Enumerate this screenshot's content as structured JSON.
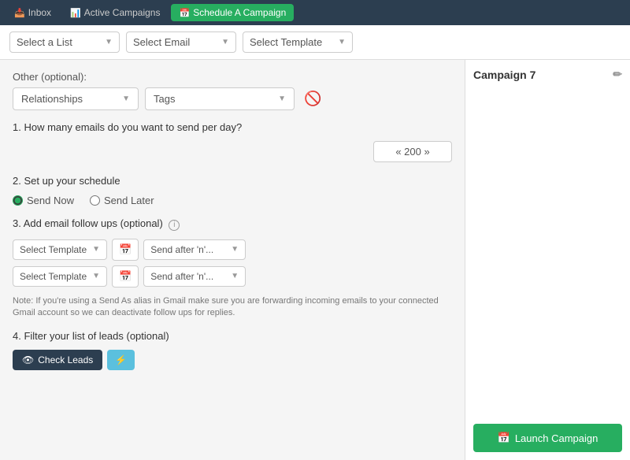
{
  "topnav": {
    "inbox_label": "Inbox",
    "active_campaigns_label": "Active Campaigns",
    "schedule_campaign_label": "Schedule A Campaign",
    "inbox_icon": "📥",
    "active_icon": "📊",
    "schedule_icon": "📅"
  },
  "subheader": {
    "list_placeholder": "Select a List",
    "email_placeholder": "Select Email",
    "template_placeholder": "Select Template"
  },
  "main": {
    "other_label": "Other (optional):",
    "relationships_placeholder": "Relationships",
    "tags_placeholder": "Tags",
    "q1_label": "1. How many emails do you want to send per day?",
    "emails_value": "« 200 »",
    "q2_label": "2. Set up your schedule",
    "send_now_label": "Send Now",
    "send_later_label": "Send Later",
    "q3_label": "3. Add email follow ups (optional)",
    "followup1_template_placeholder": "Select Template",
    "followup1_send_placeholder": "Send after 'n'...",
    "followup2_template_placeholder": "Select Template",
    "followup2_send_placeholder": "Send after 'n'...",
    "note_text": "Note: If you're using a Send As alias in Gmail make sure you are forwarding incoming emails to your connected Gmail account so we can deactivate follow ups for replies.",
    "q4_label": "4. Filter your list of leads (optional)",
    "check_leads_label": "Check Leads",
    "eye_icon": "👁",
    "lightning_icon": "⚡"
  },
  "right_panel": {
    "campaign_name": "Campaign 7",
    "edit_icon": "✏",
    "launch_label": "Launch Campaign",
    "launch_icon": "📅"
  }
}
